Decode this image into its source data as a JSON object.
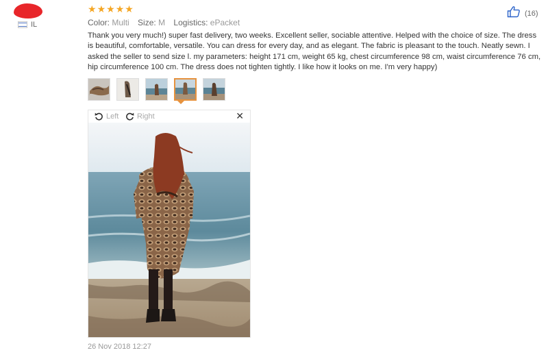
{
  "reviewer": {
    "country_code": "IL"
  },
  "rating": {
    "stars": 5
  },
  "meta": {
    "color_label": "Color:",
    "color_value": "Multi",
    "size_label": "Size:",
    "size_value": "M",
    "logistics_label": "Logistics:",
    "logistics_value": "ePacket"
  },
  "likes": {
    "count": "(16)"
  },
  "review": {
    "text": "Thank you very much!) super fast delivery, two weeks. Excellent seller, sociable attentive. Helped with the choice of size. The dress is beautiful, comfortable, versatile. You can dress for every day, and as elegant. The fabric is pleasant to the touch. Neatly sewn. I asked the seller to send size l. my parameters: height 171 cm, weight 65 kg, chest circumference 98 cm, waist circumference 76 cm, hip circumference 100 cm. The dress does not tighten tightly. I like how it looks on me. I'm very happy)"
  },
  "thumbnails": {
    "count": 5,
    "active_index": 3
  },
  "viewer": {
    "rotate_left_label": "Left",
    "rotate_right_label": "Right"
  },
  "date": "26 Nov 2018 12:27",
  "colors": {
    "star": "#f5a623",
    "active_thumb": "#e6923e",
    "redaction": "#e8262a"
  }
}
